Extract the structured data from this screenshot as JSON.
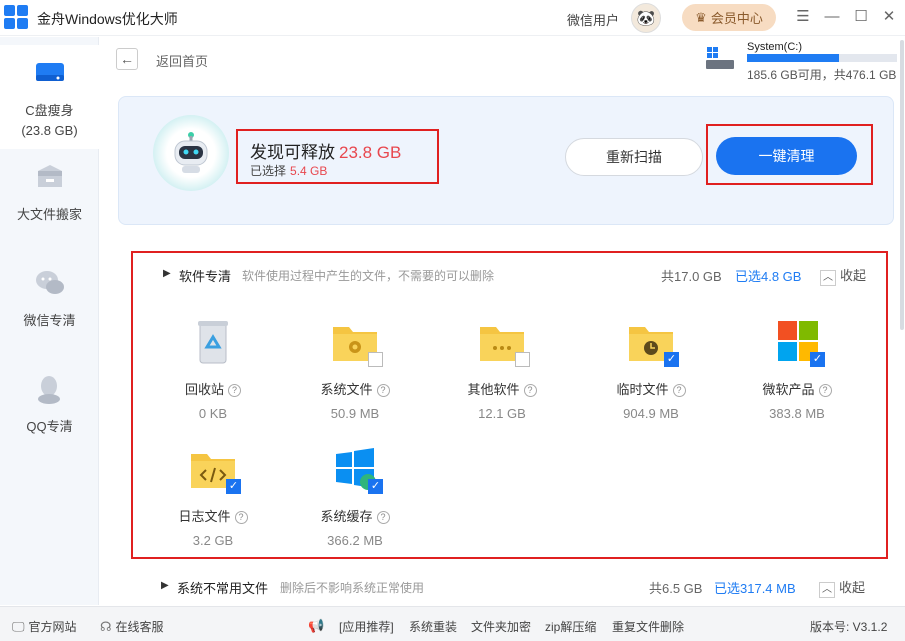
{
  "app": {
    "title": "金舟Windows优化大师"
  },
  "header": {
    "user_name": "微信用户",
    "vip_label": "会员中心",
    "window_controls": [
      "menu",
      "minimize",
      "maximize",
      "close"
    ]
  },
  "sidebar": {
    "items": [
      {
        "label": "C盘瘦身",
        "sub": "(23.8 GB)",
        "icon": "disk-icon",
        "active": true
      },
      {
        "label": "大文件搬家",
        "icon": "box-icon"
      },
      {
        "label": "微信专清",
        "icon": "wechat-icon"
      },
      {
        "label": "QQ专清",
        "icon": "qq-icon"
      }
    ]
  },
  "nav": {
    "back_label": "返回首页"
  },
  "disk": {
    "name": "System(C:)",
    "info": "185.6 GB可用，共476.1 GB",
    "used_fraction": 0.61
  },
  "banner": {
    "found_label": "发现可释放",
    "found_amount": "23.8 GB",
    "selected_label": "已选择",
    "selected_amount": "5.4 GB",
    "rescan_label": "重新扫描",
    "clean_label": "一键清理"
  },
  "section1": {
    "title": "软件专清",
    "desc": "软件使用过程中产生的文件，不需要的可以删除",
    "total": "共17.0 GB",
    "selected": "已选4.8 GB",
    "collapse_label": "收起",
    "items": [
      {
        "name": "回收站",
        "size": "0 KB",
        "icon": "recycle-bin-icon",
        "checked": null
      },
      {
        "name": "系统文件",
        "size": "50.9 MB",
        "icon": "system-folder-icon",
        "checked": false
      },
      {
        "name": "其他软件",
        "size": "12.1 GB",
        "icon": "other-folder-icon",
        "checked": false
      },
      {
        "name": "临时文件",
        "size": "904.9 MB",
        "icon": "temp-folder-icon",
        "checked": true
      },
      {
        "name": "微软产品",
        "size": "383.8 MB",
        "icon": "microsoft-icon",
        "checked": true
      },
      {
        "name": "日志文件",
        "size": "3.2 GB",
        "icon": "log-folder-icon",
        "checked": true
      },
      {
        "name": "系统缓存",
        "size": "366.2 MB",
        "icon": "windows-cache-icon",
        "checked": true
      }
    ]
  },
  "section2": {
    "title": "系统不常用文件",
    "desc": "删除后不影响系统正常使用",
    "total": "共6.5 GB",
    "selected": "已选317.4 MB",
    "collapse_label": "收起"
  },
  "footer": {
    "website": "官方网站",
    "support": "在线客服",
    "recommend": "[应用推荐]",
    "links": [
      "系统重装",
      "文件夹加密",
      "zip解压缩",
      "重复文件删除"
    ],
    "version": "版本号: V3.1.2"
  },
  "colors": {
    "accent": "#1a73f0",
    "highlight": "#e8474e",
    "annotation": "#e02020"
  }
}
